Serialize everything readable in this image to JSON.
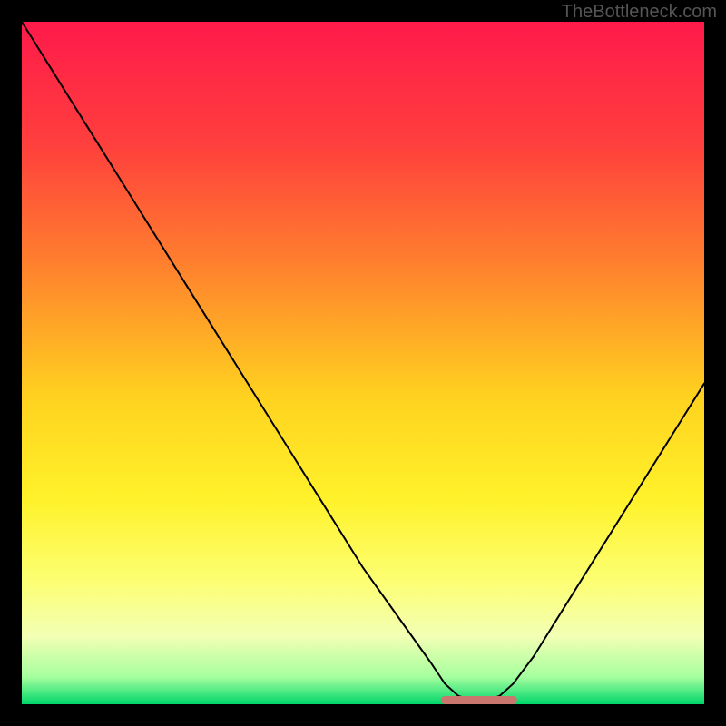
{
  "watermark": "TheBottleneck.com",
  "chart_data": {
    "type": "line",
    "title": "",
    "xlabel": "",
    "ylabel": "",
    "xlim": [
      0,
      100
    ],
    "ylim": [
      0,
      100
    ],
    "series": [
      {
        "name": "bottleneck-curve",
        "x": [
          0,
          5,
          10,
          15,
          20,
          25,
          30,
          35,
          40,
          45,
          50,
          55,
          60,
          62,
          64,
          66,
          68,
          70,
          72,
          75,
          80,
          85,
          90,
          95,
          100
        ],
        "y": [
          100,
          92,
          84,
          76,
          68,
          60,
          52,
          44,
          36,
          28,
          20,
          13,
          6,
          3,
          1.2,
          0.6,
          0.6,
          1.2,
          3,
          7,
          15,
          23,
          31,
          39,
          47
        ]
      },
      {
        "name": "optimal-band-indicator",
        "x": [
          62,
          72
        ],
        "y": [
          0.6,
          0.6
        ]
      }
    ],
    "gradient_stops": [
      {
        "pct": 0,
        "color": "#ff1a4b"
      },
      {
        "pct": 18,
        "color": "#ff3f3d"
      },
      {
        "pct": 35,
        "color": "#ff7e2e"
      },
      {
        "pct": 55,
        "color": "#ffd21f"
      },
      {
        "pct": 70,
        "color": "#fff22a"
      },
      {
        "pct": 82,
        "color": "#fcff73"
      },
      {
        "pct": 90,
        "color": "#f3ffb4"
      },
      {
        "pct": 96,
        "color": "#a6ff9e"
      },
      {
        "pct": 100,
        "color": "#00d66b"
      }
    ],
    "colors": {
      "curve": "#000000",
      "indicator": "#c9766f",
      "frame": "#000000"
    }
  }
}
